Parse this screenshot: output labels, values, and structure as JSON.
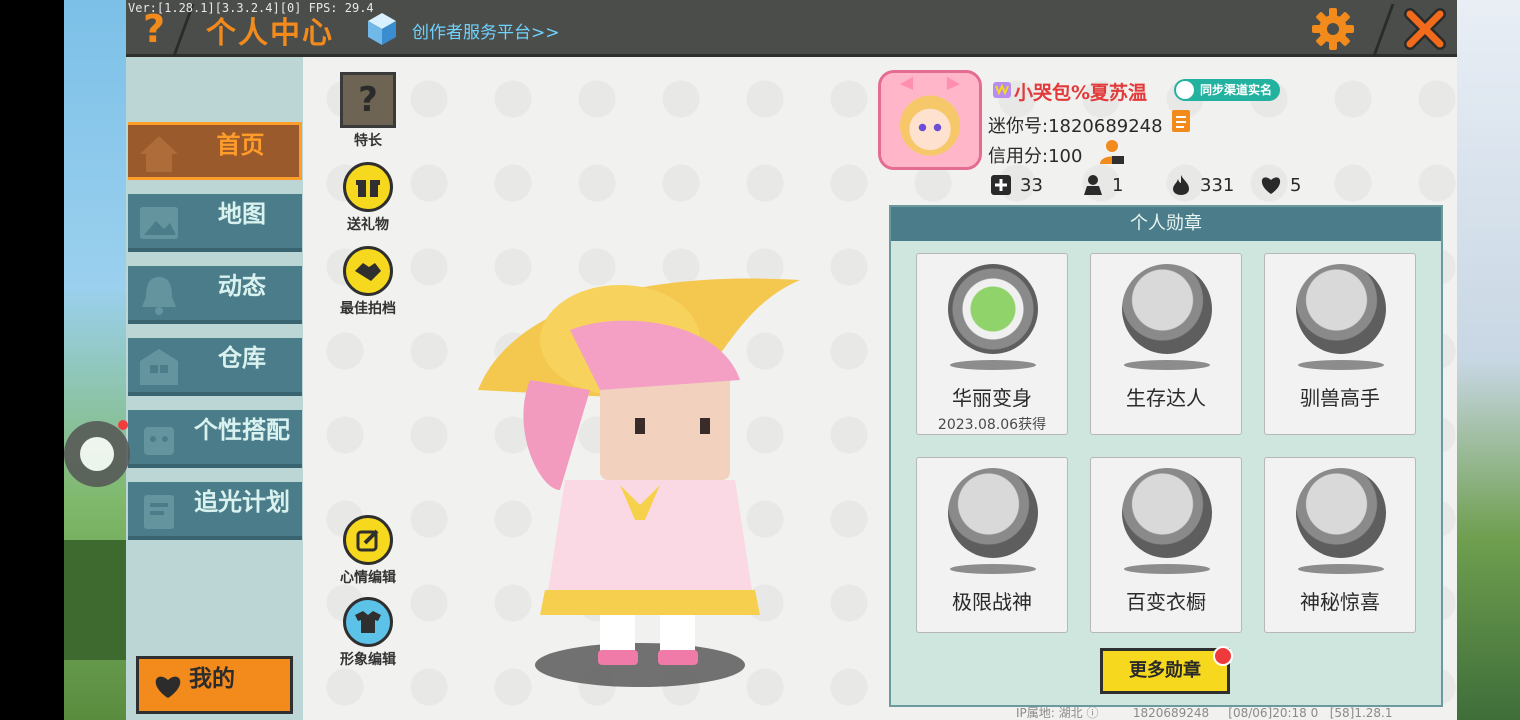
{
  "debug_text": "Ver:[1.28.1][3.3.2.4][0] FPS: 29.4",
  "header": {
    "help_label": "?",
    "title": "个人中心",
    "creator_link": "创作者服务平台>>"
  },
  "sidebar": {
    "items": [
      {
        "label": "首页",
        "icon": "house-icon"
      },
      {
        "label": "地图",
        "icon": "picture-icon"
      },
      {
        "label": "动态",
        "icon": "bell-icon"
      },
      {
        "label": "仓库",
        "icon": "warehouse-icon"
      },
      {
        "label": "个性搭配",
        "icon": "robot-icon"
      },
      {
        "label": "追光计划",
        "icon": "notebook-icon"
      }
    ],
    "mine_label": "我的"
  },
  "actions": {
    "specialty": "特长",
    "send_gift": "送礼物",
    "best_partner": "最佳拍档",
    "mood_edit": "心情编辑",
    "image_edit": "形象编辑"
  },
  "profile": {
    "nickname": "小哭包%夏苏温",
    "sync_badge": "同步渠道实名",
    "mini_id": "迷你号:1820689248",
    "credit": "信用分:100",
    "stats": {
      "friends": "33",
      "followers": "1",
      "heat": "331",
      "likes": "5"
    }
  },
  "medals": {
    "header": "个人勋章",
    "items": [
      {
        "name": "华丽变身",
        "date": "2023.08.06获得"
      },
      {
        "name": "生存达人",
        "date": ""
      },
      {
        "name": "驯兽高手",
        "date": ""
      },
      {
        "name": "极限战神",
        "date": ""
      },
      {
        "name": "百变衣橱",
        "date": ""
      },
      {
        "name": "神秘惊喜",
        "date": ""
      }
    ],
    "more_label": "更多勋章"
  },
  "footer": {
    "ip_location": "IP属地: 湖北",
    "id": "1820689248",
    "time": "[08/06]20:18 0",
    "version": "[58]1.28.1"
  },
  "colors": {
    "accent": "#f28a1c",
    "teal": "#4a7d89",
    "yellow": "#f6d91e",
    "nickname": "#e23a3a"
  }
}
